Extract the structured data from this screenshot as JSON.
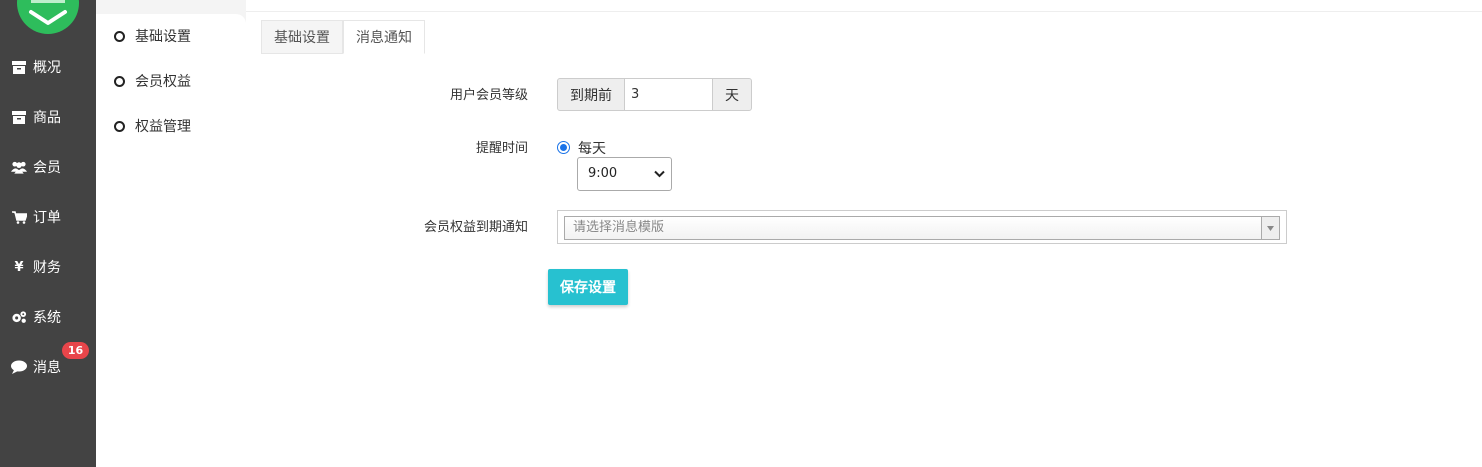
{
  "sidebar": {
    "items": [
      {
        "label": "概况",
        "icon": "archive-icon"
      },
      {
        "label": "商品",
        "icon": "archive-icon"
      },
      {
        "label": "会员",
        "icon": "users-icon"
      },
      {
        "label": "订单",
        "icon": "cart-icon"
      },
      {
        "label": "财务",
        "icon": "yen-icon"
      },
      {
        "label": "系统",
        "icon": "gears-icon"
      },
      {
        "label": "消息",
        "icon": "chat-icon"
      }
    ],
    "message_badge": "16"
  },
  "submenu": {
    "items": [
      "基础设置",
      "会员权益",
      "权益管理"
    ]
  },
  "tabs": [
    {
      "label": "基础设置",
      "active": false
    },
    {
      "label": "消息通知",
      "active": true
    }
  ],
  "form": {
    "level_label": "用户会员等级",
    "level_prefix": "到期前",
    "level_value": "3",
    "level_suffix": "天",
    "remind_label": "提醒时间",
    "remind_option": "每天",
    "remind_time": "9:00",
    "notify_label": "会员权益到期通知",
    "notify_placeholder": "请选择消息模版",
    "save_label": "保存设置"
  },
  "colors": {
    "sidebar_bg": "#434343",
    "accent": "#27c1d0",
    "badge": "#e8454a",
    "logo": "#2ebd5c"
  }
}
